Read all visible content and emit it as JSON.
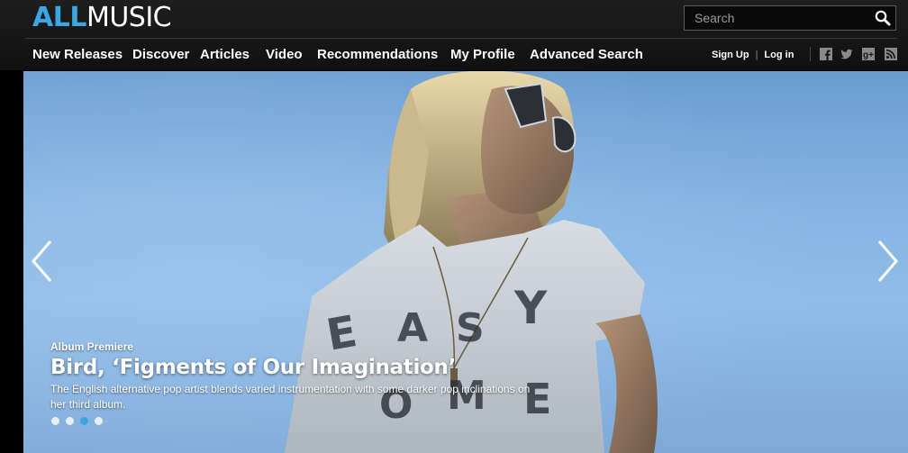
{
  "brand": {
    "logo_prefix": "ALL",
    "logo_suffix": "MUSIC",
    "accent_color": "#3aa7e3"
  },
  "search": {
    "placeholder": "Search",
    "button_icon": "search-icon"
  },
  "nav": {
    "items": [
      {
        "label": "New Releases"
      },
      {
        "label": "Discover"
      },
      {
        "label": "Articles"
      },
      {
        "label": "Video"
      },
      {
        "label": "Recommendations"
      },
      {
        "label": "My Profile"
      },
      {
        "label": "Advanced Search"
      }
    ]
  },
  "auth": {
    "sign_up": "Sign Up",
    "separator": "|",
    "log_in": "Log in"
  },
  "social": [
    "facebook-icon",
    "twitter-icon",
    "google-plus-icon",
    "rss-icon"
  ],
  "hero": {
    "kicker": "Album Premiere",
    "headline": "Bird, ‘Figments of Our Imagination’",
    "blurb": "The English alternative pop artist blends varied instrumentation with some darker pop inclinations on her third album.",
    "shirt_text": "EASY COME",
    "slide_count": 4,
    "active_slide": 3,
    "prev_icon": "chevron-left-icon",
    "next_icon": "chevron-right-icon"
  }
}
